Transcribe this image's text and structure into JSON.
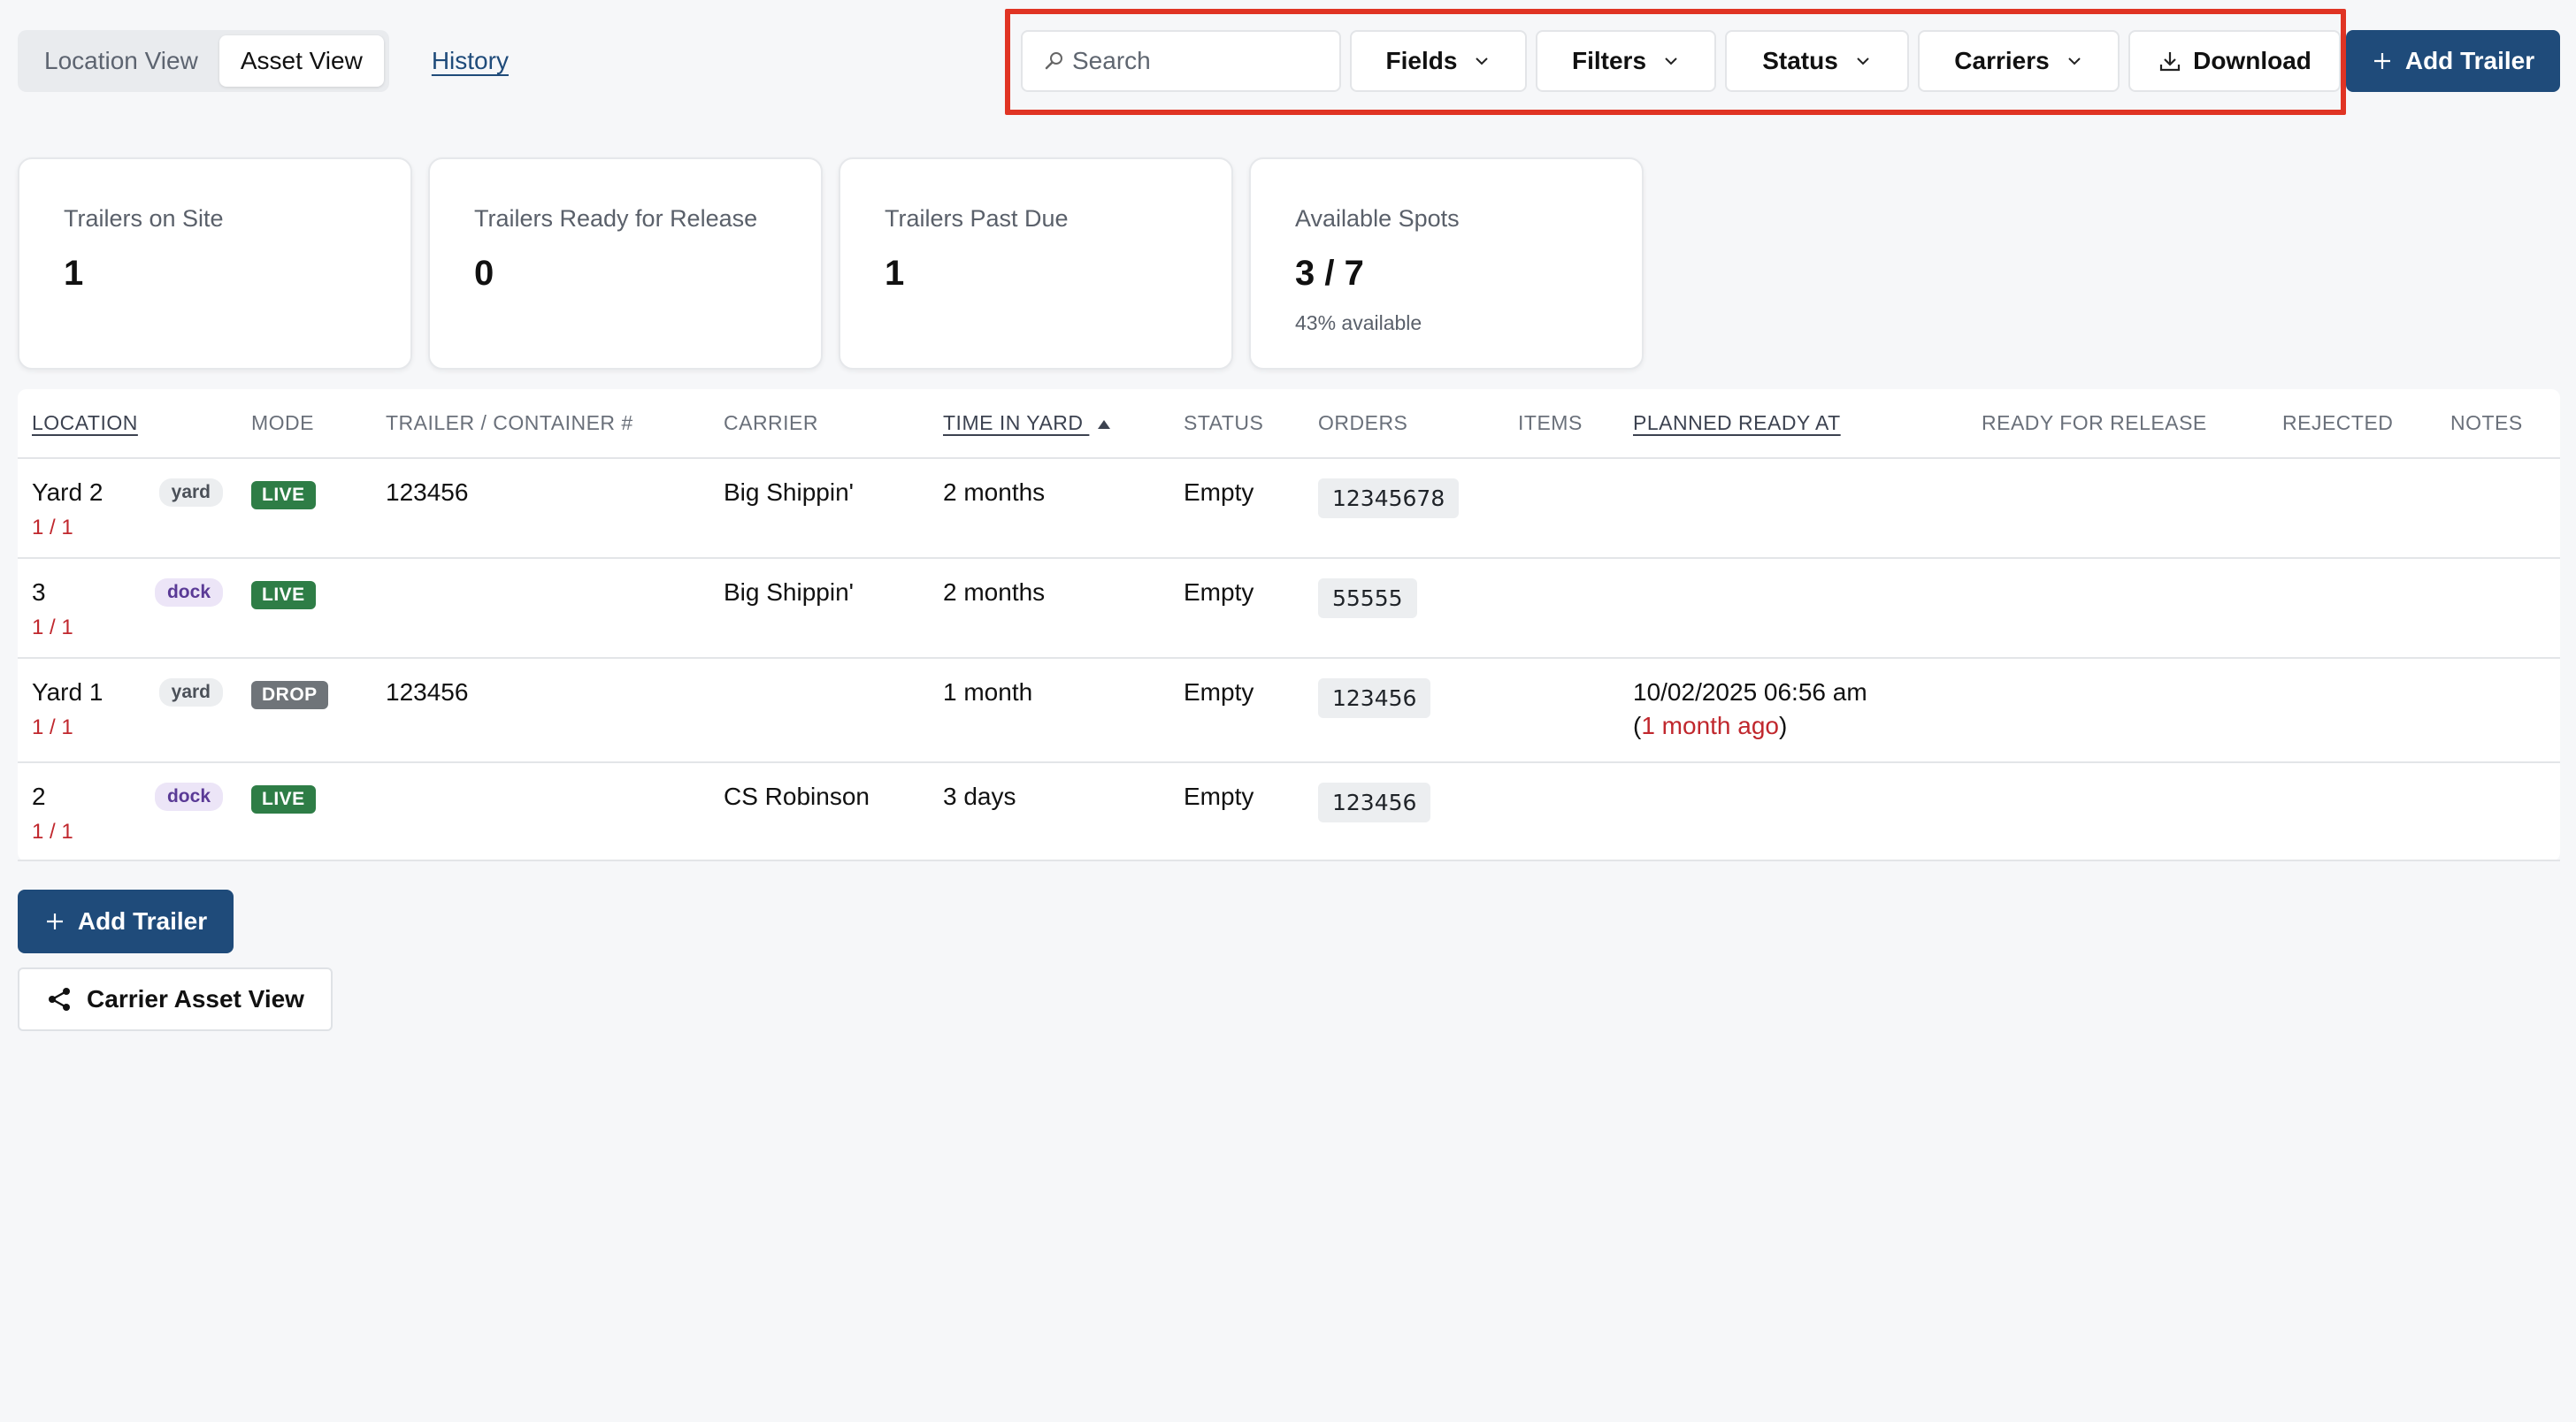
{
  "views": {
    "location_label": "Location View",
    "asset_label": "Asset View",
    "history_label": "History"
  },
  "toolbar": {
    "search_placeholder": "Search",
    "fields_label": "Fields",
    "filters_label": "Filters",
    "status_label": "Status",
    "carriers_label": "Carriers",
    "download_label": "Download",
    "add_trailer_label": "Add Trailer",
    "highlight_color": "#e03424"
  },
  "stats": [
    {
      "label": "Trailers on Site",
      "value": "1"
    },
    {
      "label": "Trailers Ready for Release",
      "value": "0"
    },
    {
      "label": "Trailers Past Due",
      "value": "1"
    },
    {
      "label": "Available Spots",
      "value": "3 / 7",
      "sub": "43% available"
    }
  ],
  "table": {
    "headers": {
      "location": "LOCATION",
      "mode": "MODE",
      "trailer": "TRAILER / CONTAINER #",
      "carrier": "CARRIER",
      "time_in_yard": "TIME IN YARD",
      "status": "STATUS",
      "orders": "ORDERS",
      "items": "ITEMS",
      "planned_ready_at": "PLANNED READY AT",
      "ready_for_release": "READY FOR RELEASE",
      "rejected": "REJECTED",
      "notes": "NOTES"
    },
    "rows": [
      {
        "location": "Yard 2",
        "fraction": "1 / 1",
        "tag": "yard",
        "mode": "LIVE",
        "trailer": "123456",
        "carrier": "Big Shippin'",
        "time_in_yard": "2 months",
        "status": "Empty",
        "order": "12345678",
        "planned_ready_at": "",
        "planned_relative": ""
      },
      {
        "location": "3",
        "fraction": "1 / 1",
        "tag": "dock",
        "mode": "LIVE",
        "trailer": "",
        "carrier": "Big Shippin'",
        "time_in_yard": "2 months",
        "status": "Empty",
        "order": "55555",
        "planned_ready_at": "",
        "planned_relative": ""
      },
      {
        "location": "Yard 1",
        "fraction": "1 / 1",
        "tag": "yard",
        "mode": "DROP",
        "trailer": "123456",
        "carrier": "",
        "time_in_yard": "1 month",
        "status": "Empty",
        "order": "123456",
        "planned_ready_at": "10/02/2025 06:56 am",
        "planned_relative": "1 month ago"
      },
      {
        "location": "2",
        "fraction": "1 / 1",
        "tag": "dock",
        "mode": "LIVE",
        "trailer": "",
        "carrier": "CS Robinson",
        "time_in_yard": "3 days",
        "status": "Empty",
        "order": "123456",
        "planned_ready_at": "",
        "planned_relative": ""
      }
    ]
  },
  "bottom": {
    "add_trailer_label": "Add Trailer",
    "carrier_asset_view_label": "Carrier Asset View"
  }
}
